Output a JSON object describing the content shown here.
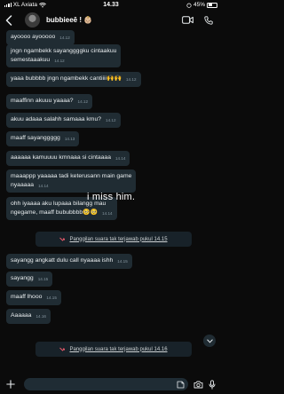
{
  "status_bar": {
    "carrier": "XL Axiata",
    "time": "14.33",
    "battery_text": "45%"
  },
  "header": {
    "contact_name": "bubbieeē ! 👶🏼"
  },
  "messages": [
    {
      "text": "ayoooo ayooooo",
      "time": "14.12"
    },
    {
      "text": "jngn ngambekk sayanggggku cintaakuu\nsemestaaakuu",
      "time": "14.12"
    },
    {
      "text": "yaaa bubbbb jngn ngambekk cantiiii🙌🙌",
      "time": "14.12"
    },
    {
      "text": "maaffinn akuuu yaaaa?",
      "time": "14.12"
    },
    {
      "text": "akuu adaaa salahh samaaa kmu?",
      "time": "14.12"
    },
    {
      "text": "maaff sayanggggg",
      "time": "14.13"
    },
    {
      "text": "aaaaaa kamuuuu kmnaaa si cintaaaa",
      "time": "14.14"
    },
    {
      "text": "maaappp yaaaaa tadi keterusann main game\nnyaaaaa",
      "time": "14.14"
    },
    {
      "text": "ohh iyaaaa aku lupaaa bilangg mau\nngegame, maaff bububbbb🥺🥺",
      "time": "14.14"
    },
    {
      "text": "sayangg angkatt dulu call nyaaaa ishh",
      "time": "14.15"
    },
    {
      "text": "sayangg",
      "time": "14.15"
    },
    {
      "text": "maaff lhooo",
      "time": "14.15"
    },
    {
      "text": "Aaaaaa",
      "time": "14.16"
    }
  ],
  "missed_calls": [
    {
      "text": "Panggilan suara tak terjawab pukul 14.15"
    },
    {
      "text": "Panggilan suara tak terjawab pukul 14.16"
    }
  ],
  "overlay": {
    "caption": "i miss him."
  },
  "colors": {
    "background": "#0b0b0b",
    "bubble": "#202c33",
    "missed_call_icon": "#f15c6d",
    "accent": "#00a884"
  },
  "icons": {
    "back": "chevron-left-icon",
    "video_call": "video-camera-icon",
    "voice_call": "phone-icon",
    "add": "plus-icon",
    "sticker": "sticker-icon",
    "camera": "camera-icon",
    "mic": "microphone-icon",
    "missed_call": "missed-call-icon",
    "scroll_down": "chevron-down-icon"
  }
}
